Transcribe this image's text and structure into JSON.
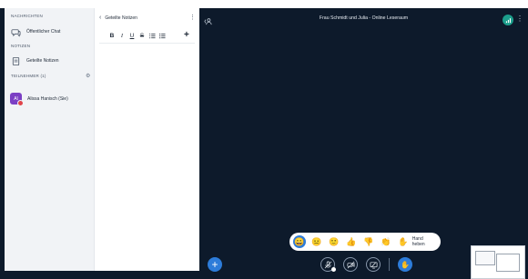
{
  "sidebar": {
    "messages_header": "NACHRICHTEN",
    "public_chat": "Öffentlicher Chat",
    "notes_header": "NOTIZEN",
    "shared_notes": "Geteilte Notizen",
    "participants_header": "TEILNEHMER (1)",
    "user": {
      "name": "Alissa Hanisch (Sie)",
      "initials": "Al"
    }
  },
  "notes_panel": {
    "title": "Geteilte Notizen",
    "toolbar": [
      "B",
      "I",
      "U",
      "S"
    ]
  },
  "video": {
    "title": "Frau Schmidt und Julia - Online Leseraum"
  },
  "reactions": {
    "hand_label": "Hand heben"
  },
  "colors": {
    "accent": "#2d7cd9",
    "background": "#0d1a2b",
    "status": "#1c9e8c"
  }
}
